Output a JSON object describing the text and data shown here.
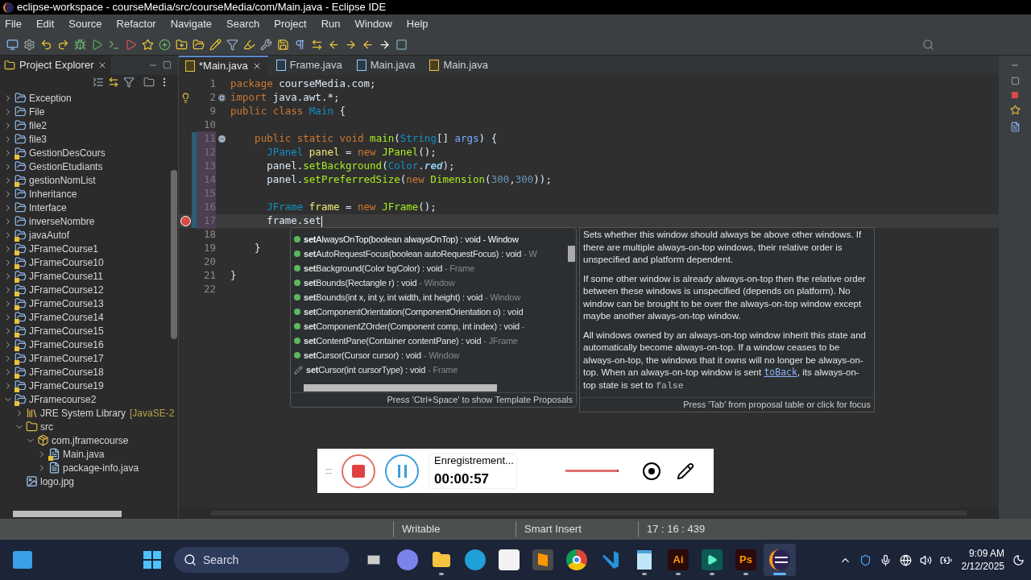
{
  "window": {
    "title": "eclipse-workspace - courseMedia/src/courseMedia/com/Main.java - Eclipse IDE"
  },
  "menu": [
    "File",
    "Edit",
    "Source",
    "Refactor",
    "Navigate",
    "Search",
    "Project",
    "Run",
    "Window",
    "Help"
  ],
  "explorer": {
    "title": "Project Explorer",
    "items": [
      {
        "label": "Exception",
        "kind": "project",
        "warning": false,
        "expanded": false
      },
      {
        "label": "File",
        "kind": "project",
        "warning": false,
        "expanded": false
      },
      {
        "label": "file2",
        "kind": "project",
        "warning": false,
        "expanded": false
      },
      {
        "label": "file3",
        "kind": "project",
        "warning": false,
        "expanded": false
      },
      {
        "label": "GestionDesCours",
        "kind": "project",
        "warning": true,
        "expanded": false
      },
      {
        "label": "GestionEtudiants",
        "kind": "project",
        "warning": false,
        "expanded": false
      },
      {
        "label": "gestionNomList",
        "kind": "project",
        "warning": true,
        "expanded": false
      },
      {
        "label": "Inheritance",
        "kind": "project",
        "warning": false,
        "expanded": false
      },
      {
        "label": "Interface",
        "kind": "project",
        "warning": false,
        "expanded": false
      },
      {
        "label": "inverseNombre",
        "kind": "project",
        "warning": false,
        "expanded": false
      },
      {
        "label": "javaAutof",
        "kind": "project",
        "warning": true,
        "expanded": false
      },
      {
        "label": "JFrameCourse1",
        "kind": "project",
        "warning": true,
        "expanded": false
      },
      {
        "label": "JFrameCourse10",
        "kind": "project",
        "warning": true,
        "expanded": false
      },
      {
        "label": "JFrameCourse11",
        "kind": "project",
        "warning": true,
        "expanded": false
      },
      {
        "label": "JFrameCourse12",
        "kind": "project",
        "warning": true,
        "expanded": false
      },
      {
        "label": "JFrameCourse13",
        "kind": "project",
        "warning": true,
        "expanded": false
      },
      {
        "label": "JFrameCourse14",
        "kind": "project",
        "warning": true,
        "expanded": false
      },
      {
        "label": "JFrameCourse15",
        "kind": "project",
        "warning": true,
        "expanded": false
      },
      {
        "label": "JFrameCourse16",
        "kind": "project",
        "warning": true,
        "expanded": false
      },
      {
        "label": "JFrameCourse17",
        "kind": "project",
        "warning": true,
        "expanded": false
      },
      {
        "label": "JFrameCourse18",
        "kind": "project",
        "warning": true,
        "expanded": false
      },
      {
        "label": "JFrameCourse19",
        "kind": "project",
        "warning": true,
        "expanded": false
      },
      {
        "label": "JFramecourse2",
        "kind": "project",
        "warning": true,
        "expanded": true,
        "children": [
          {
            "label": "JRE System Library",
            "decoration": "[JavaSE-2",
            "kind": "library",
            "warning": false,
            "expanded": false
          },
          {
            "label": "src",
            "kind": "source-folder",
            "warning": false,
            "expanded": true,
            "children": [
              {
                "label": "com.jframecourse",
                "kind": "package",
                "warning": false,
                "expanded": true,
                "children": [
                  {
                    "label": "Main.java",
                    "kind": "java-file",
                    "warning": true,
                    "expanded": false
                  },
                  {
                    "label": "package-info.java",
                    "kind": "java-file",
                    "warning": false,
                    "expanded": false
                  }
                ]
              }
            ]
          },
          {
            "label": "logo.jpg",
            "kind": "image-file",
            "warning": false
          }
        ]
      }
    ]
  },
  "tabs": [
    {
      "label": "*Main.java",
      "selected": true,
      "warning": true
    },
    {
      "label": "Frame.java",
      "selected": false,
      "warning": false
    },
    {
      "label": "Main.java",
      "selected": false,
      "warning": false
    },
    {
      "label": "Main.java",
      "selected": false,
      "warning": true
    }
  ],
  "code": [
    {
      "number": "1",
      "current": false,
      "changed": false,
      "tokens": [
        {
          "text": "package",
          "kind": "keyword"
        },
        {
          "text": " courseMedia.com;",
          "kind": "plain"
        }
      ]
    },
    {
      "number": "2",
      "current": false,
      "changed": false,
      "collapsed": true,
      "annotation": {
        "kind": "note"
      },
      "tokens": [
        {
          "text": "import",
          "kind": "keyword"
        },
        {
          "text": " java.awt.*;",
          "kind": "plain"
        }
      ]
    },
    {
      "number": "9",
      "current": false,
      "changed": false,
      "tokens": [
        {
          "text": "public class",
          "kind": "keyword"
        },
        {
          "text": " Main",
          "kind": "type"
        },
        {
          "text": " {",
          "kind": "plain"
        }
      ]
    },
    {
      "number": "10",
      "current": false,
      "changed": false
    },
    {
      "number": "11",
      "current": false,
      "changed": true,
      "collapsed": false,
      "tokens": [
        {
          "text": "    public static void",
          "kind": "keyword"
        },
        {
          "text": " main",
          "kind": "method"
        },
        {
          "text": "(",
          "kind": "plain"
        },
        {
          "text": "String",
          "kind": "type"
        },
        {
          "text": "[]",
          "kind": "plain"
        },
        {
          "text": " args",
          "kind": "param"
        },
        {
          "text": ") {",
          "kind": "plain"
        }
      ]
    },
    {
      "number": "12",
      "current": false,
      "changed": true,
      "tokens": [
        {
          "text": "      JPanel",
          "kind": "type"
        },
        {
          "text": " panel",
          "kind": "local"
        },
        {
          "text": " = ",
          "kind": "plain"
        },
        {
          "text": "new",
          "kind": "keyword"
        },
        {
          "text": " JPanel",
          "kind": "method"
        },
        {
          "text": "();",
          "kind": "plain"
        }
      ]
    },
    {
      "number": "13",
      "current": false,
      "changed": true,
      "tokens": [
        {
          "text": "      panel.",
          "kind": "plain"
        },
        {
          "text": "setBackground",
          "kind": "method"
        },
        {
          "text": "(",
          "kind": "plain"
        },
        {
          "text": "Color",
          "kind": "type"
        },
        {
          "text": ".",
          "kind": "plain"
        },
        {
          "text": "red",
          "kind": "constant"
        },
        {
          "text": ");",
          "kind": "plain"
        }
      ]
    },
    {
      "number": "14",
      "current": false,
      "changed": true,
      "tokens": [
        {
          "text": "      panel.",
          "kind": "plain"
        },
        {
          "text": "setPreferredSize",
          "kind": "method"
        },
        {
          "text": "(",
          "kind": "plain"
        },
        {
          "text": "new",
          "kind": "keyword"
        },
        {
          "text": " Dimension",
          "kind": "method"
        },
        {
          "text": "(",
          "kind": "plain"
        },
        {
          "text": "300",
          "kind": "number"
        },
        {
          "text": ",",
          "kind": "plain"
        },
        {
          "text": "300",
          "kind": "number"
        },
        {
          "text": "));",
          "kind": "plain"
        }
      ]
    },
    {
      "number": "15",
      "current": false,
      "changed": true
    },
    {
      "number": "16",
      "current": false,
      "changed": true,
      "tokens": [
        {
          "text": "      JFrame",
          "kind": "type"
        },
        {
          "text": " frame",
          "kind": "local"
        },
        {
          "text": " = ",
          "kind": "plain"
        },
        {
          "text": "new",
          "kind": "keyword"
        },
        {
          "text": " JFrame",
          "kind": "method"
        },
        {
          "text": "();",
          "kind": "plain"
        }
      ]
    },
    {
      "number": "17",
      "current": true,
      "changed": true,
      "annotation": {
        "kind": "error"
      },
      "tokens": [
        {
          "text": "      frame.set",
          "kind": "plain"
        }
      ]
    },
    {
      "number": "18",
      "current": false,
      "changed": false
    },
    {
      "number": "19",
      "current": false,
      "changed": false,
      "tokens": [
        {
          "text": "    }",
          "kind": "plain"
        }
      ]
    },
    {
      "number": "20",
      "current": false,
      "changed": false
    },
    {
      "number": "21",
      "current": false,
      "changed": false,
      "tokens": [
        {
          "text": "}",
          "kind": "plain"
        }
      ]
    },
    {
      "number": "22",
      "current": false,
      "changed": false
    }
  ],
  "completion": {
    "items": [
      {
        "match": "set",
        "rest": "AlwaysOnTop(boolean alwaysOnTop) : void",
        "qualifier": " - Window",
        "kind": "method",
        "selected": true
      },
      {
        "match": "set",
        "rest": "AutoRequestFocus(boolean autoRequestFocus) : void",
        "qualifier": " - W",
        "kind": "method",
        "selected": false
      },
      {
        "match": "set",
        "rest": "Background(Color bgColor) : void",
        "qualifier": " - Frame",
        "kind": "method",
        "selected": false
      },
      {
        "match": "set",
        "rest": "Bounds(Rectangle r) : void",
        "qualifier": " - Window",
        "kind": "method",
        "selected": false
      },
      {
        "match": "set",
        "rest": "Bounds(int x, int y, int width, int height) : void",
        "qualifier": " - Window",
        "kind": "method",
        "selected": false
      },
      {
        "match": "set",
        "rest": "ComponentOrientation(ComponentOrientation o) : void",
        "kind": "method",
        "selected": false
      },
      {
        "match": "set",
        "rest": "ComponentZOrder(Component comp, int index) : void",
        "qualifier": " -",
        "kind": "method",
        "selected": false
      },
      {
        "match": "set",
        "rest": "ContentPane(Container contentPane) : void",
        "qualifier": " - JFrame",
        "kind": "method",
        "selected": false
      },
      {
        "match": "set",
        "rest": "Cursor(Cursor cursor) : void",
        "qualifier": " - Window",
        "kind": "method",
        "selected": false
      },
      {
        "match": "set",
        "rest": "Cursor(int cursorType) : void",
        "qualifier": " - Frame",
        "kind": "deprecated",
        "selected": false
      }
    ],
    "hint": "Press 'Ctrl+Space' to show Template Proposals"
  },
  "docs": {
    "paragraphs": [
      [
        {
          "text": "Sets whether this window should always be above other windows. If there are multiple always-on-top windows, their relative order is unspecified and platform dependent.",
          "kind": "plain"
        }
      ],
      [
        {
          "text": "If some other window is already always-on-top then the relative order between these windows is unspecified (depends on platform). No window can be brought to be over the always-on-top window except maybe another always-on-top window.",
          "kind": "plain"
        }
      ],
      [
        {
          "text": "All windows owned by an always-on-top window inherit this state and automatically become always-on-top. If a window ceases to be always-on-top, the windows that it owns will no longer be always-on-top. When an always-on-top window is sent ",
          "kind": "plain"
        },
        {
          "text": "toBack",
          "kind": "link"
        },
        {
          "text": ", its always-on-top state is set to ",
          "kind": "plain"
        },
        {
          "text": "false",
          "kind": "code"
        }
      ]
    ],
    "hint": "Press 'Tab' from proposal table or click for focus"
  },
  "recorder": {
    "status": "Enregistrement...",
    "time": "00:00:57"
  },
  "status_bar": [
    "Writable",
    "Smart Insert",
    "17 : 16 : 439"
  ],
  "taskbar": {
    "search": {
      "placeholder": "Search"
    },
    "apps": [
      {
        "kind": "task-view",
        "running": false,
        "selected": false
      },
      {
        "kind": "chat",
        "running": false,
        "selected": false
      },
      {
        "kind": "files",
        "running": true,
        "selected": false
      },
      {
        "kind": "browser-edge",
        "running": false,
        "selected": false
      },
      {
        "kind": "store",
        "running": false,
        "selected": false
      },
      {
        "kind": "sublime",
        "running": false,
        "selected": false
      },
      {
        "kind": "browser-chrome",
        "running": false,
        "selected": false
      },
      {
        "kind": "vscode",
        "running": false,
        "selected": false
      },
      {
        "kind": "notepad",
        "running": true,
        "selected": false
      },
      {
        "kind": "letters",
        "label": "Ai",
        "running": true,
        "selected": false
      },
      {
        "kind": "filmora",
        "running": true,
        "selected": false
      },
      {
        "kind": "letters",
        "label": "Ps",
        "running": true,
        "selected": false
      },
      {
        "kind": "eclipse",
        "running": true,
        "selected": true
      }
    ],
    "time": "9:09 AM",
    "date": "2/12/2025"
  }
}
